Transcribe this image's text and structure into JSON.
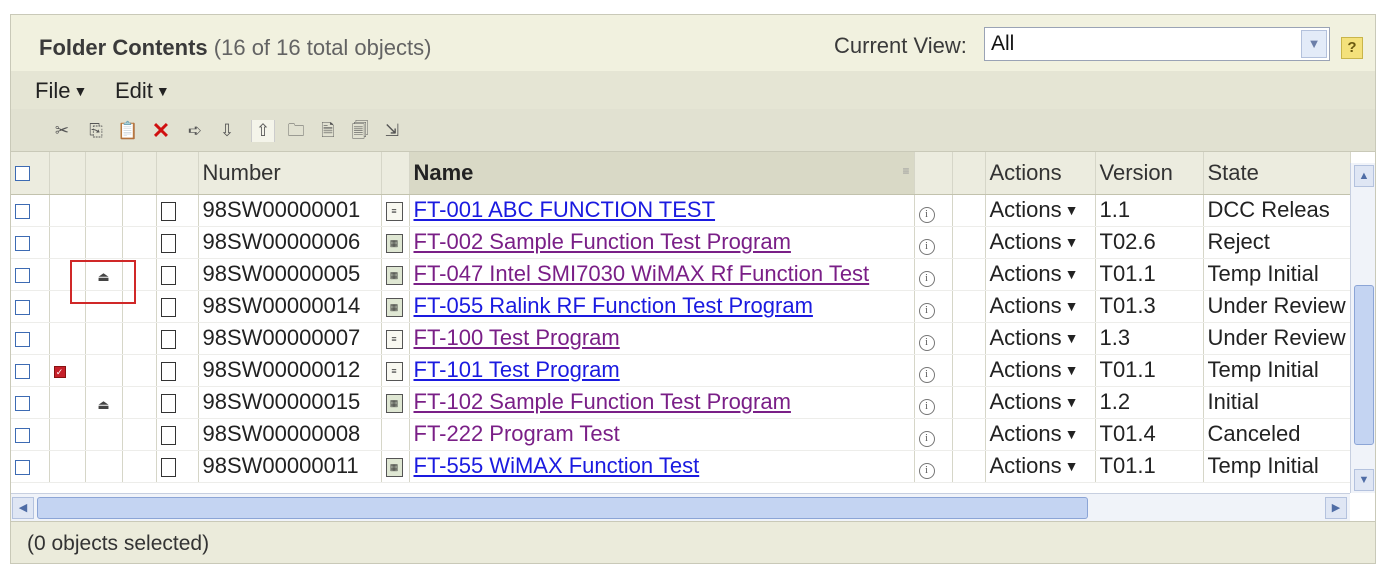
{
  "header": {
    "title_bold": "Folder Contents",
    "title_count": " (16 of 16 total objects)",
    "current_view_label": "Current View:",
    "current_view_value": "All",
    "help_label": "?"
  },
  "menu": {
    "file": "File",
    "edit": "Edit"
  },
  "toolbar": {
    "icons": [
      "cut-icon",
      "copy-icon",
      "paste-icon",
      "delete-icon",
      "move-icon",
      "check-in-icon",
      "check-out-icon",
      "new-folder-icon",
      "new-document-icon",
      "new-document-from-template-icon",
      "import-icon"
    ]
  },
  "columns": {
    "number": "Number",
    "name": "Name",
    "actions": "Actions",
    "version": "Version",
    "state": "State"
  },
  "rows": [
    {
      "number": "98SW00000001",
      "name": "FT-001 ABC FUNCTION TEST",
      "action": "Actions",
      "version": "1.1",
      "state": "DCC Releas"
    },
    {
      "number": "98SW00000006",
      "name": "FT-002 Sample Function Test Program",
      "action": "Actions",
      "version": "T02.6",
      "state": "Reject"
    },
    {
      "number": "98SW00000005",
      "name": "FT-047 Intel SMI7030 WiMAX Rf Function Test",
      "action": "Actions",
      "version": "T01.1",
      "state": "Temp Initial"
    },
    {
      "number": "98SW00000014",
      "name": "FT-055 Ralink RF Function Test Program",
      "action": "Actions",
      "version": "T01.3",
      "state": "Under Review"
    },
    {
      "number": "98SW00000007",
      "name": "FT-100 Test Program",
      "action": "Actions",
      "version": "1.3",
      "state": "Under Review"
    },
    {
      "number": "98SW00000012",
      "name": "FT-101 Test Program",
      "action": "Actions",
      "version": "T01.1",
      "state": "Temp Initial"
    },
    {
      "number": "98SW00000015",
      "name": "FT-102 Sample Function Test Program",
      "action": "Actions",
      "version": "1.2",
      "state": "Initial"
    },
    {
      "number": "98SW00000008",
      "name": "FT-222 Program Test",
      "action": "Actions",
      "version": "T01.4",
      "state": "Canceled"
    },
    {
      "number": "98SW00000011",
      "name": "FT-555 WiMAX Function Test",
      "action": "Actions",
      "version": "T01.1",
      "state": "Temp Initial"
    }
  ],
  "status": {
    "selected_text": "(0 objects selected)"
  },
  "colors": {
    "link": "#1a1ae0",
    "visited_link": "#7a1f87",
    "highlight": "#d02828"
  }
}
